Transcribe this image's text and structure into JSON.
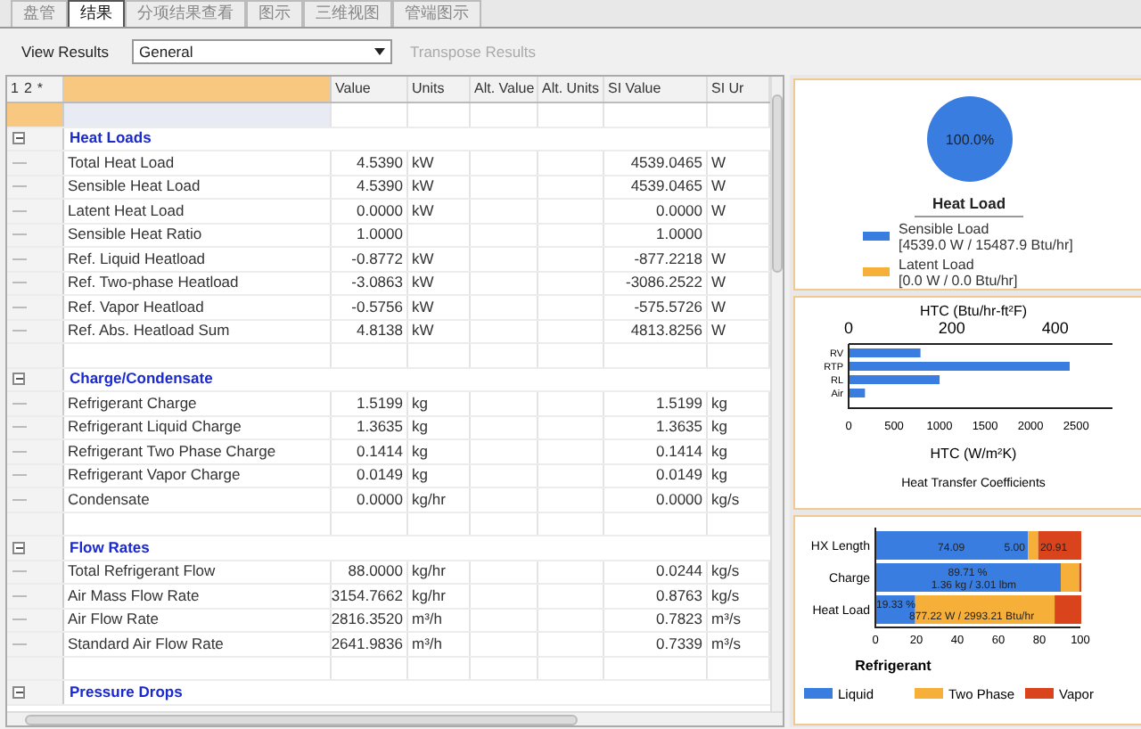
{
  "tabs": [
    {
      "label": "盘管",
      "selected": false
    },
    {
      "label": "结果",
      "selected": true
    },
    {
      "label": "分项结果查看",
      "selected": false
    },
    {
      "label": "图示",
      "selected": false
    },
    {
      "label": "三维视图",
      "selected": false
    },
    {
      "label": "管端图示",
      "selected": false
    }
  ],
  "toolbar": {
    "label": "View Results",
    "dropdown_value": "General",
    "transpose_button": {
      "label": "Transpose Results",
      "disabled": true
    }
  },
  "grid": {
    "row_header_labels": [
      "1",
      "2",
      "*"
    ],
    "columns": [
      "Value",
      "Units",
      "Alt. Value",
      "Alt. Units",
      "SI Value",
      "SI Ur"
    ],
    "sections": [
      {
        "title": "Heat Loads",
        "expanded": true,
        "rows": [
          {
            "label": "Total Heat Load",
            "value": "4.5390",
            "units": "kW",
            "si_value": "4539.0465",
            "si_units": "W"
          },
          {
            "label": "Sensible Heat Load",
            "value": "4.5390",
            "units": "kW",
            "si_value": "4539.0465",
            "si_units": "W"
          },
          {
            "label": "Latent Heat Load",
            "value": "0.0000",
            "units": "kW",
            "si_value": "0.0000",
            "si_units": "W"
          },
          {
            "label": "Sensible Heat Ratio",
            "value": "1.0000",
            "si_value": "1.0000"
          },
          {
            "label": "Ref. Liquid Heatload",
            "value": "-0.8772",
            "units": "kW",
            "si_value": "-877.2218",
            "si_units": "W"
          },
          {
            "label": "Ref. Two-phase Heatload",
            "value": "-3.0863",
            "units": "kW",
            "si_value": "-3086.2522",
            "si_units": "W"
          },
          {
            "label": "Ref. Vapor Heatload",
            "value": "-0.5756",
            "units": "kW",
            "si_value": "-575.5726",
            "si_units": "W"
          },
          {
            "label": "Ref. Abs. Heatload Sum",
            "value": "4.8138",
            "units": "kW",
            "si_value": "4813.8256",
            "si_units": "W"
          }
        ]
      },
      {
        "title": "Charge/Condensate",
        "expanded": true,
        "rows": [
          {
            "label": "Refrigerant Charge",
            "value": "1.5199",
            "units": "kg",
            "si_value": "1.5199",
            "si_units": "kg"
          },
          {
            "label": "Refrigerant Liquid Charge",
            "value": "1.3635",
            "units": "kg",
            "si_value": "1.3635",
            "si_units": "kg"
          },
          {
            "label": "Refrigerant Two Phase Charge",
            "value": "0.1414",
            "units": "kg",
            "si_value": "0.1414",
            "si_units": "kg"
          },
          {
            "label": "Refrigerant Vapor Charge",
            "value": "0.0149",
            "units": "kg",
            "si_value": "0.0149",
            "si_units": "kg"
          },
          {
            "label": "Condensate",
            "value": "0.0000",
            "units": "kg/hr",
            "si_value": "0.0000",
            "si_units": "kg/s"
          }
        ]
      },
      {
        "title": "Flow Rates",
        "expanded": true,
        "rows": [
          {
            "label": "Total Refrigerant Flow",
            "value": "88.0000",
            "units": "kg/hr",
            "si_value": "0.0244",
            "si_units": "kg/s"
          },
          {
            "label": "Air Mass Flow Rate",
            "value": "3154.7662",
            "units": "kg/hr",
            "si_value": "0.8763",
            "si_units": "kg/s"
          },
          {
            "label": "Air Flow Rate",
            "value": "2816.3520",
            "units": "m³/h",
            "si_value": "0.7823",
            "si_units": "m³/s"
          },
          {
            "label": "Standard Air Flow Rate",
            "value": "2641.9836",
            "units": "m³/h",
            "si_value": "0.7339",
            "si_units": "m³/s"
          }
        ]
      },
      {
        "title": "Pressure Drops",
        "expanded": true
      }
    ]
  },
  "charts": [
    {
      "chart_data": {
        "type": "pie",
        "title": "Heat Load",
        "categories": [
          "Sensible Load",
          "Latent Load"
        ],
        "values": [
          100,
          0
        ],
        "value_labels": [
          "100.0%",
          null
        ]
      },
      "legend": [
        {
          "reading": "[4539.0 W / 15487.9 Btu/hr]",
          "color": "#3a7de0"
        },
        {
          "reading": "[0.0 W / 0.0 Btu/hr]",
          "color": "#f6b03a"
        }
      ]
    },
    {
      "chart_data": {
        "type": "bar",
        "orientation": "horizontal",
        "title": "Heat Transfer Coefficients",
        "xlabel": "HTC (W/m²K)",
        "categories": [
          "RV",
          "RTP",
          "RL",
          "Air"
        ],
        "series": [
          {
            "color": "#3a7de0",
            "values": [
              780,
              2420,
              990,
              170
            ]
          }
        ],
        "xlim": [
          0,
          2900
        ],
        "xticks": [
          0,
          500,
          1000,
          1500,
          2000,
          2500
        ]
      },
      "top_axis": {
        "label": "HTC (Btu/hr-ft²F)",
        "ticks": [
          "0",
          "200",
          "400"
        ]
      }
    },
    {
      "chart_data": {
        "type": "bar",
        "orientation": "horizontal",
        "stacked": true,
        "categories": [
          "HX Length",
          "Charge",
          "Heat Load"
        ],
        "series": [
          {
            "name": "Liquid",
            "color": "#3a7de0",
            "values": [
              74,
              90,
              19
            ]
          },
          {
            "name": "Two Phase",
            "color": "#f6b03a",
            "values": [
              5,
              9,
              68
            ]
          },
          {
            "name": "Vapor",
            "color": "#d9441c",
            "values": [
              21,
              1,
              13
            ]
          }
        ],
        "xlim": [
          0,
          100
        ],
        "xticks": [
          0,
          20,
          40,
          60,
          80,
          100
        ],
        "annotations": [
          "74.09",
          "5.00",
          "20.91",
          "89.71 %",
          "1.36 kg / 3.01 lbm",
          "19.33 %",
          "877.22 W / 2993.21 Btu/hr"
        ],
        "legend": {
          "title": "Refrigerant"
        }
      }
    }
  ]
}
